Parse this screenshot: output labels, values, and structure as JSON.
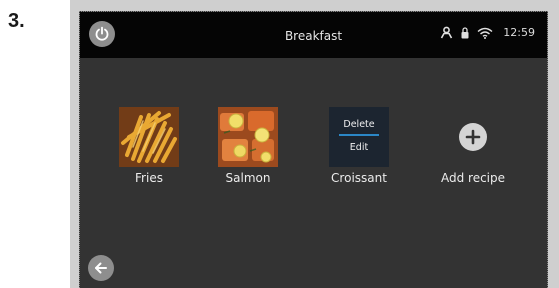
{
  "step_number": "3.",
  "status_bar": {
    "title": "Breakfast",
    "time": "12:59",
    "icons": [
      "power-icon",
      "user-icon",
      "lock-icon",
      "wifi-icon"
    ]
  },
  "recipes": [
    {
      "name": "Fries",
      "icon": "fries-thumbnail"
    },
    {
      "name": "Salmon",
      "icon": "salmon-thumbnail"
    },
    {
      "name": "Croissant",
      "icon": "context-menu"
    }
  ],
  "context_menu": {
    "delete_label": "Delete",
    "edit_label": "Edit"
  },
  "add_recipe": {
    "label": "Add recipe",
    "icon": "plus-icon"
  },
  "navigation": {
    "back_icon": "arrow-left-icon"
  },
  "colors": {
    "screen_bg": "#333333",
    "status_bar_bg": "#050505",
    "accent": "#2b87c6",
    "button_gray": "#8e8e8e",
    "frame_gray": "#cfcfcf"
  }
}
